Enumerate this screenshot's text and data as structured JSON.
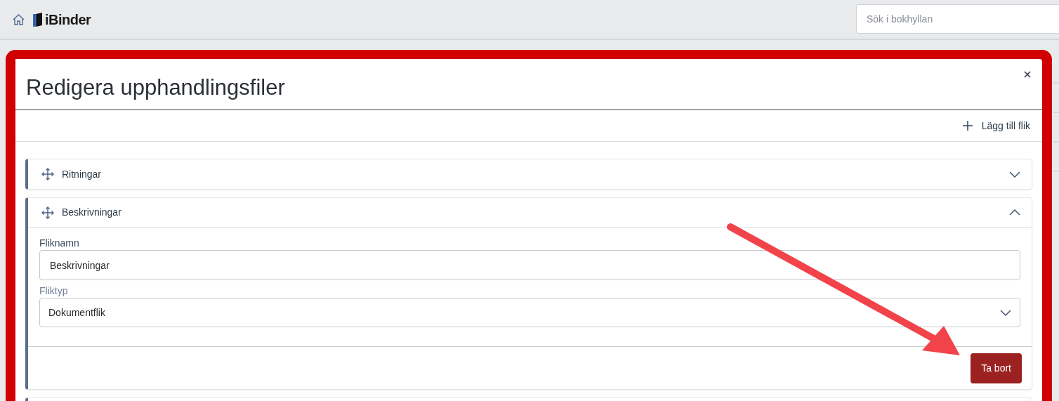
{
  "header": {
    "logo_text": "iBinder",
    "search": {
      "placeholder": "Sök i bokhyllan"
    }
  },
  "modal": {
    "title": "Redigera upphandlingsfiler",
    "add_tab_button": "Lägg till flik",
    "panels": [
      {
        "title": "Ritningar",
        "expanded": false
      },
      {
        "title": "Beskrivningar",
        "expanded": true,
        "fields": [
          {
            "kind": "text",
            "label": "Fliknamn",
            "value": "Beskrivningar"
          },
          {
            "kind": "select",
            "label": "Fliktyp",
            "value": "Dokumentflik"
          }
        ],
        "delete_button": "Ta bort"
      }
    ]
  }
}
